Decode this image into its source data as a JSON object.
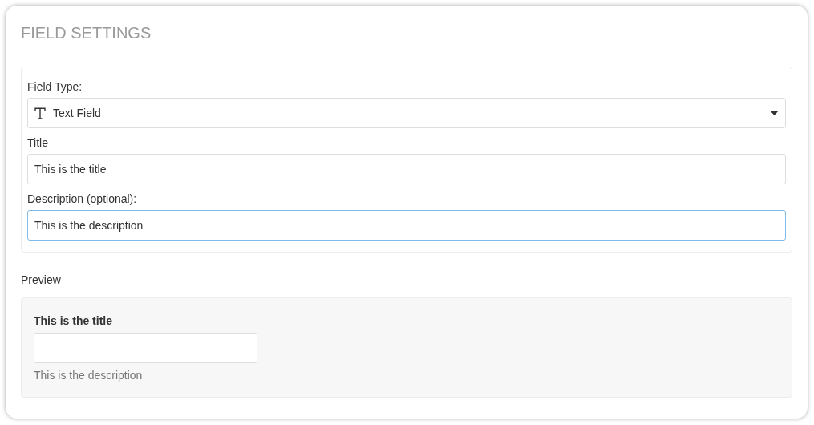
{
  "panel": {
    "title": "FIELD SETTINGS"
  },
  "settings": [
    {
      "kind": "select",
      "label": "Field Type:",
      "value": "Text Field",
      "focused": false
    },
    {
      "kind": "text",
      "label": "Title",
      "value": "This is the title",
      "focused": false
    },
    {
      "kind": "text",
      "label": "Description (optional):",
      "value": "This is the description",
      "focused": true
    }
  ],
  "preview": {
    "heading": "Preview",
    "label": "This is the title",
    "help": "This is the description"
  }
}
